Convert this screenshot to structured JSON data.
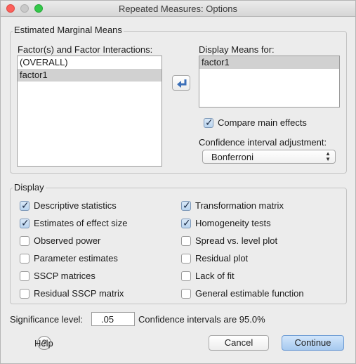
{
  "window": {
    "title": "Repeated Measures: Options"
  },
  "emm": {
    "legend": "Estimated Marginal Means",
    "factors_label": "Factor(s) and Factor Interactions:",
    "factors": [
      "(OVERALL)",
      "factor1"
    ],
    "display_label": "Display Means for:",
    "display_items": [
      "factor1"
    ],
    "compare_label": "Compare main effects",
    "compare_checked": true,
    "ci_adjust_label": "Confidence interval adjustment:",
    "ci_adjust_value": "Bonferroni"
  },
  "display": {
    "legend": "Display",
    "options_left": [
      {
        "label": "Descriptive statistics",
        "checked": true
      },
      {
        "label": "Estimates of effect size",
        "checked": true
      },
      {
        "label": "Observed power",
        "checked": false
      },
      {
        "label": "Parameter estimates",
        "checked": false
      },
      {
        "label": "SSCP matrices",
        "checked": false
      },
      {
        "label": "Residual SSCP matrix",
        "checked": false
      }
    ],
    "options_right": [
      {
        "label": "Transformation matrix",
        "checked": true
      },
      {
        "label": "Homogeneity tests",
        "checked": true
      },
      {
        "label": "Spread vs. level plot",
        "checked": false
      },
      {
        "label": "Residual plot",
        "checked": false
      },
      {
        "label": "Lack of fit",
        "checked": false
      },
      {
        "label": "General estimable function",
        "checked": false
      }
    ]
  },
  "significance": {
    "label": "Significance level:",
    "value": ".05",
    "ci_text": "Confidence intervals are 95.0%"
  },
  "buttons": {
    "help": "Help",
    "cancel": "Cancel",
    "continue": "Continue"
  }
}
